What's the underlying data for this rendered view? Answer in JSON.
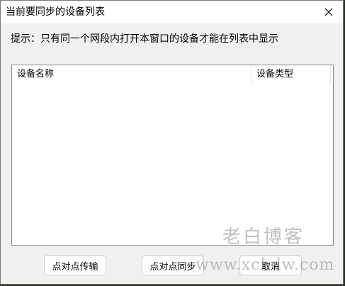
{
  "window": {
    "title": "当前要同步的设备列表",
    "close_icon": "close-icon"
  },
  "hint": "提示：只有同一个网段内打开本窗口的设备才能在列表中显示",
  "device_list": {
    "columns": [
      "设备名称",
      "设备类型"
    ],
    "rows": []
  },
  "buttons": {
    "transfer_label": "点对点传输",
    "sync_label": "点对点同步",
    "cancel_label": "取消"
  },
  "watermark": {
    "text": "老白博客",
    "url": "www.xcbdw.com"
  }
}
